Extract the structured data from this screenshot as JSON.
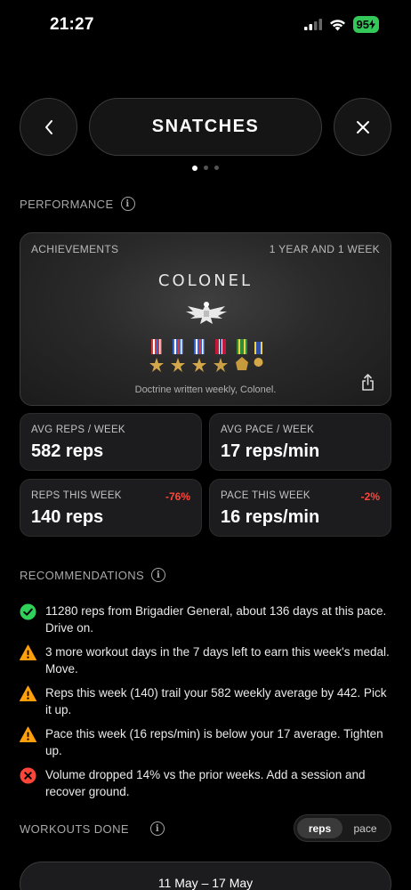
{
  "status": {
    "time": "21:27",
    "battery": "95"
  },
  "header": {
    "title": "SNATCHES"
  },
  "pager": {
    "count": 3,
    "active": 0
  },
  "performance": {
    "label": "PERFORMANCE",
    "achievements": {
      "label": "ACHIEVEMENTS",
      "duration": "1 YEAR AND 1 WEEK",
      "rank": "COLONEL",
      "caption": "Doctrine written weekly, Colonel."
    },
    "stats": [
      {
        "label": "AVG REPS / WEEK",
        "value": "582 reps",
        "delta": ""
      },
      {
        "label": "AVG PACE / WEEK",
        "value": "17 reps/min",
        "delta": ""
      },
      {
        "label": "REPS THIS WEEK",
        "value": "140 reps",
        "delta": "-76%"
      },
      {
        "label": "PACE THIS WEEK",
        "value": "16 reps/min",
        "delta": "-2%"
      }
    ]
  },
  "recommendations": {
    "label": "RECOMMENDATIONS",
    "items": [
      {
        "type": "success",
        "text": "11280 reps from Brigadier General, about 136 days at this pace. Drive on."
      },
      {
        "type": "warning",
        "text": "3 more workout days in the 7 days left to earn this week's medal. Move."
      },
      {
        "type": "warning",
        "text": "Reps this week (140) trail your 582 weekly average by 442. Pick it up."
      },
      {
        "type": "warning",
        "text": "Pace this week (16 reps/min) is below your 17 average. Tighten up."
      },
      {
        "type": "error",
        "text": "Volume dropped 14% vs the prior weeks. Add a session and recover ground."
      }
    ]
  },
  "workouts": {
    "label": "WORKOUTS DONE",
    "toggle": [
      "reps",
      "pace"
    ],
    "selected": "reps",
    "week_range": "11 May – 17 May"
  },
  "colors": {
    "success": "#30d158",
    "warning": "#ff9f0a",
    "error": "#ff453a",
    "negative": "#ff453a"
  }
}
